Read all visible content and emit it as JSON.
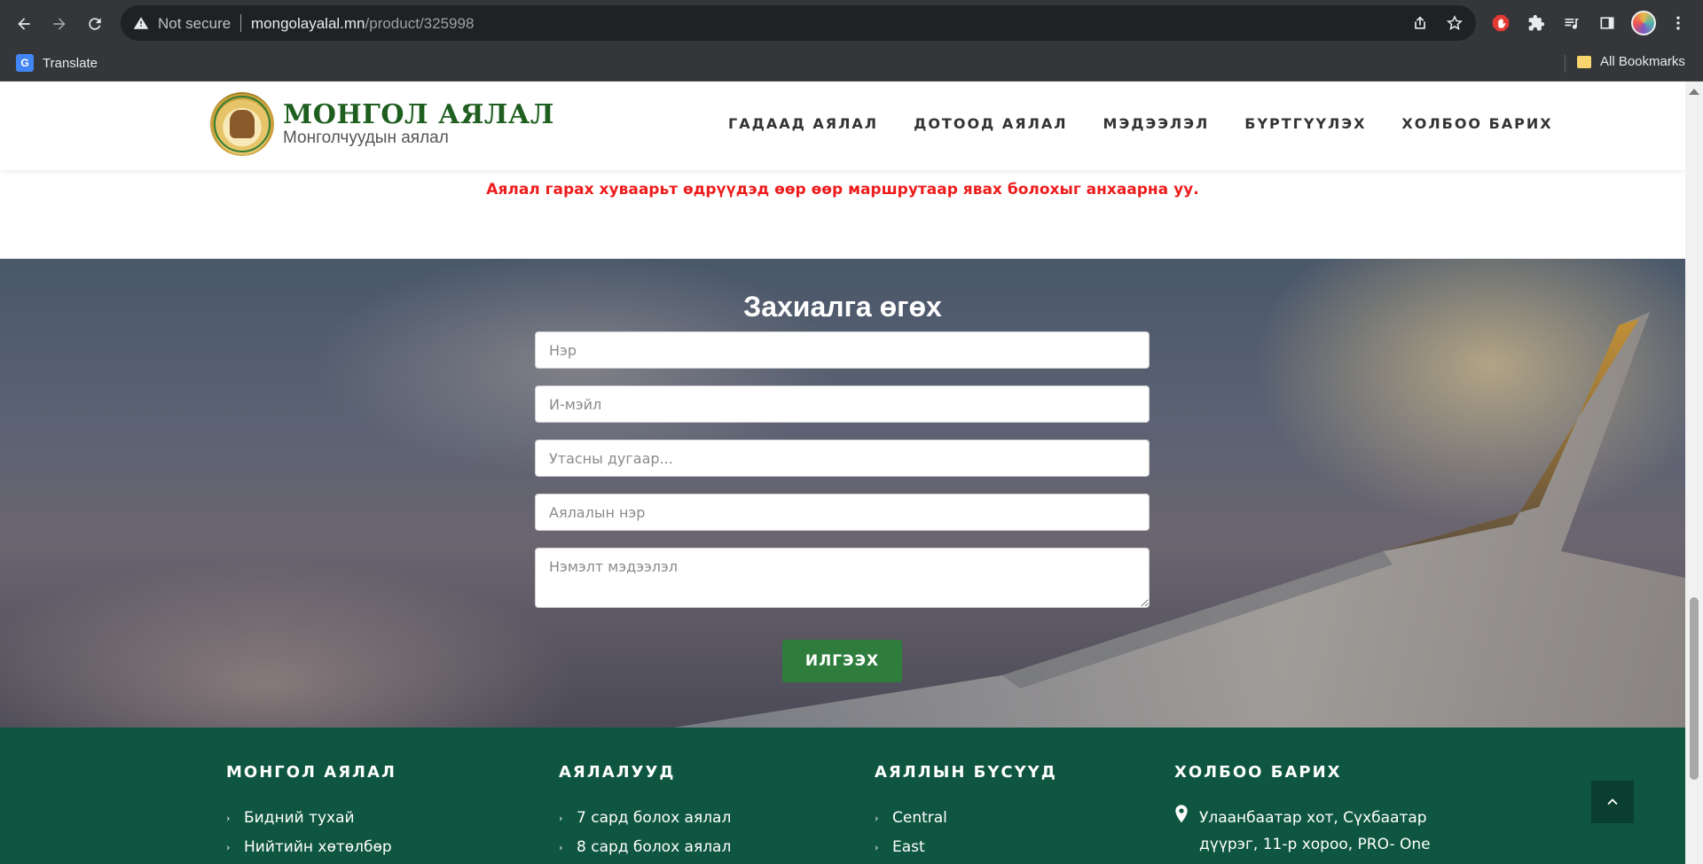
{
  "browser": {
    "security_label": "Not secure",
    "url_host": "mongolayalal.mn",
    "url_path": "/product/325998",
    "bookmarks": {
      "translate": "Translate",
      "all_bookmarks": "All Bookmarks"
    }
  },
  "header": {
    "logo_title": "МОНГОЛ АЯЛАЛ",
    "logo_subtitle": "Монголчуудын аялал",
    "nav": [
      {
        "label": "ГАДААД АЯЛАЛ"
      },
      {
        "label": "ДОТООД АЯЛАЛ"
      },
      {
        "label": "МЭДЭЭЛЭЛ"
      },
      {
        "label": "БҮРТГҮҮЛЭХ"
      },
      {
        "label": "ХОЛБОО БАРИХ"
      }
    ]
  },
  "notice": "Аялал гарах хуваарьт өдрүүдэд өөр өөр маршрутаар явах болохыг анхаарна уу.",
  "order_form": {
    "title": "Захиалга өгөх",
    "name_placeholder": "Нэр",
    "email_placeholder": "И-мэйл",
    "phone_placeholder": "Утасны дугаар...",
    "trip_placeholder": "Аялалын нэр",
    "notes_placeholder": "Нэмэлт мэдээлэл",
    "submit_label": "ИЛГЭЭХ"
  },
  "footer": {
    "col1": {
      "heading": "МОНГОЛ АЯЛАЛ",
      "items": [
        "Бидний тухай",
        "Нийтийн хөтөлбөр"
      ]
    },
    "col2": {
      "heading": "АЯЛАЛУУД",
      "items": [
        "7 сард болох аялал",
        "8 сард болох аялал"
      ]
    },
    "col3": {
      "heading": "АЯЛЛЫН БҮСҮҮД",
      "items": [
        "Central",
        "East"
      ]
    },
    "col4": {
      "heading": "ХОЛБОО БАРИХ",
      "address_line1": "Улаанбаатар хот, Сүхбаатар",
      "address_line2": "дүүрэг, 11-р хороо, PRO- One"
    }
  },
  "colors": {
    "brand_green": "#1e5e1e",
    "notice_red": "#ee1c1c",
    "submit_green": "#2e7d3c",
    "footer_bg": "#0e5640"
  }
}
